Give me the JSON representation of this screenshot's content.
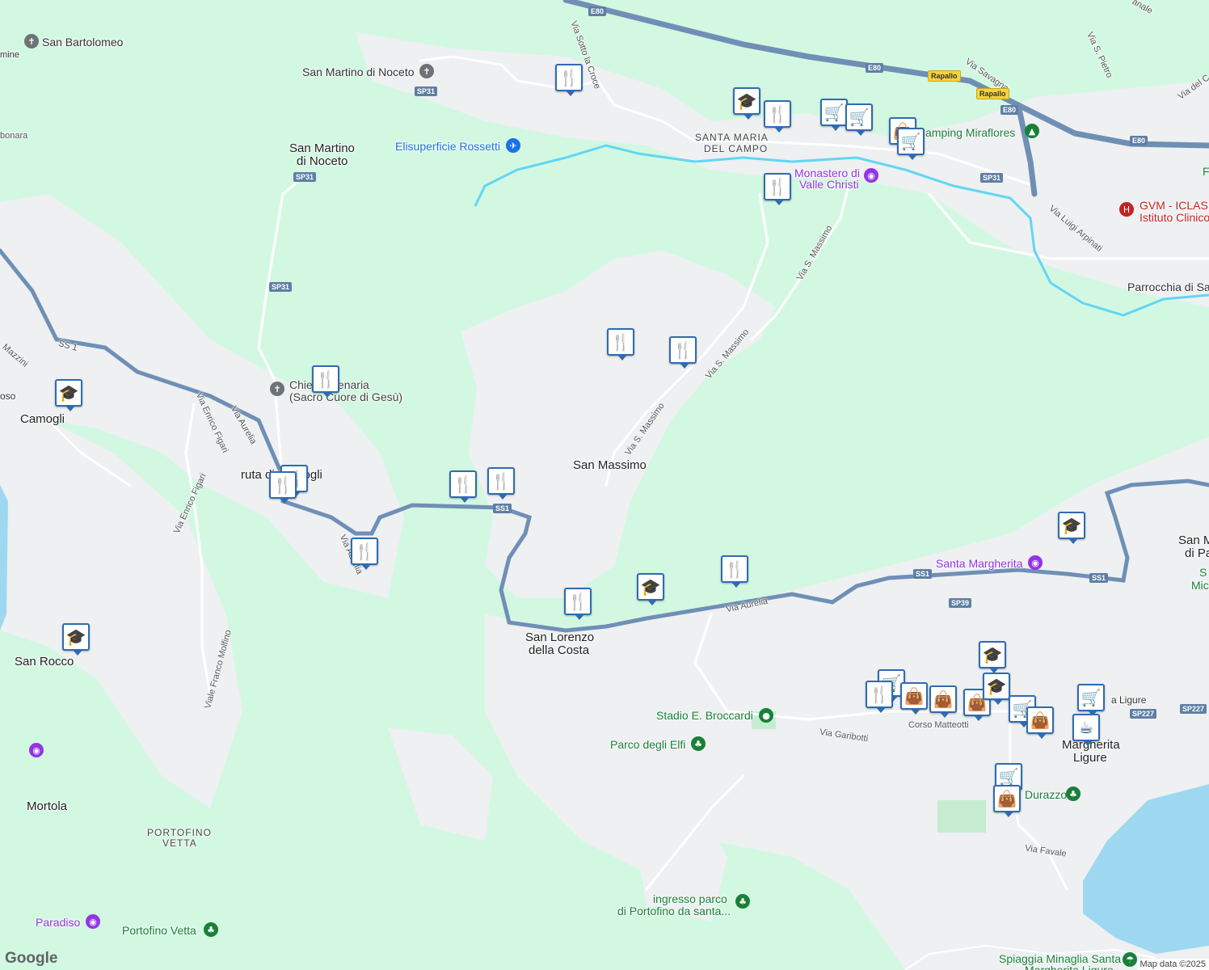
{
  "map": {
    "places": [
      {
        "id": "san-bartolomeo",
        "text": "San Bartolomeo"
      },
      {
        "id": "san-martino-noceto-a",
        "text": "San Martino di Noceto"
      },
      {
        "id": "san-martino-noceto-b1",
        "text": "San Martino"
      },
      {
        "id": "san-martino-noceto-b2",
        "text": "di Noceto"
      },
      {
        "id": "santa-maria-1",
        "text": "SANTA MARIA"
      },
      {
        "id": "santa-maria-2",
        "text": "DEL CAMPO"
      },
      {
        "id": "camogli",
        "text": "Camogli"
      },
      {
        "id": "ruta",
        "text": "ruta di Camogli"
      },
      {
        "id": "san-massimo",
        "text": "San Massimo"
      },
      {
        "id": "san-lorenzo-1",
        "text": "San Lorenzo"
      },
      {
        "id": "san-lorenzo-2",
        "text": "della Costa"
      },
      {
        "id": "san-rocco",
        "text": "San Rocco"
      },
      {
        "id": "mortola",
        "text": "Mortola"
      },
      {
        "id": "portofino-vetta-1",
        "text": "PORTOFINO"
      },
      {
        "id": "portofino-vetta-2",
        "text": "VETTA"
      },
      {
        "id": "san-m-1",
        "text": "San M"
      },
      {
        "id": "san-m-2",
        "text": "di Pa"
      },
      {
        "id": "margherita-1",
        "text": "Margherita"
      },
      {
        "id": "margherita-2",
        "text": "Ligure"
      },
      {
        "id": "parrocchia",
        "text": "Parrocchia di Sa"
      },
      {
        "id": "edge-mine",
        "text": "mine"
      },
      {
        "id": "edge-bonara",
        "text": "bonara"
      },
      {
        "id": "edge-rosso",
        "text": "oso"
      },
      {
        "id": "edge-ligure",
        "text": "a Ligure"
      },
      {
        "id": "edge-sm",
        "text": "S"
      },
      {
        "id": "edge-mic",
        "text": "Mic"
      },
      {
        "id": "edge-f",
        "text": "F"
      }
    ],
    "pois": [
      {
        "id": "elisuperficie",
        "text": "Elisuperficie Rossetti",
        "color": "#1a73e8"
      },
      {
        "id": "monastero-1",
        "text": "Monastero di",
        "color": "#9334e6"
      },
      {
        "id": "monastero-2",
        "text": "Valle Christi",
        "color": "#9334e6"
      },
      {
        "id": "camping",
        "text": "amping Miraflores",
        "color": "#188038"
      },
      {
        "id": "gvm-1",
        "text": "GVM - ICLAS",
        "color": "#c5221f"
      },
      {
        "id": "gvm-2",
        "text": "Istituto Clinico",
        "color": "#c5221f"
      },
      {
        "id": "chiesa-1",
        "text": "Chiesa Plenaria",
        "color": "#444444"
      },
      {
        "id": "chiesa-2",
        "text": "(Sacro Cuore di Gesù)",
        "color": "#444444"
      },
      {
        "id": "santa-margherita",
        "text": "Santa Margherita",
        "color": "#9334e6"
      },
      {
        "id": "stadio",
        "text": "Stadio E. Broccardi",
        "color": "#188038"
      },
      {
        "id": "parco-elfi",
        "text": "Parco degli Elfi",
        "color": "#188038"
      },
      {
        "id": "ingresso-1",
        "text": "ingresso parco",
        "color": "#188038"
      },
      {
        "id": "ingresso-2",
        "text": "di Portofino da santa...",
        "color": "#188038"
      },
      {
        "id": "paradiso",
        "text": "Paradiso",
        "color": "#9334e6"
      },
      {
        "id": "portofino-vetta-poi",
        "text": "Portofino Vetta",
        "color": "#188038"
      },
      {
        "id": "durazzo",
        "text": "Durazzo",
        "color": "#188038"
      },
      {
        "id": "spiaggia-1",
        "text": "Spiaggia Minaglia Santa",
        "color": "#188038"
      },
      {
        "id": "spiaggia-2",
        "text": "Margherita Ligure",
        "color": "#188038"
      }
    ],
    "streets": [
      {
        "id": "via-sotto-la-croce",
        "text": "Via Sotto la Croce"
      },
      {
        "id": "via-savagna",
        "text": "Via Savagna"
      },
      {
        "id": "via-s-pietro",
        "text": "Via S. Pietro"
      },
      {
        "id": "via-del-c",
        "text": "Via del C"
      },
      {
        "id": "via-luigi-arpinati",
        "text": "Via Luigi Arpinati"
      },
      {
        "id": "via-s-massimo-a",
        "text": "Via S. Massimo"
      },
      {
        "id": "via-s-massimo-b",
        "text": "Via S. Massimo"
      },
      {
        "id": "via-s-massimo-c",
        "text": "Via S. Massimo"
      },
      {
        "id": "ss1-label",
        "text": "SS 1"
      },
      {
        "id": "via-mazzini",
        "text": "Mazzini"
      },
      {
        "id": "via-enrico-figari-a",
        "text": "Via Enrico Figari"
      },
      {
        "id": "via-enrico-figari-b",
        "text": "Via Enrico Figari"
      },
      {
        "id": "via-aurelia-a",
        "text": "Via Aurelia"
      },
      {
        "id": "via-aurelia-b",
        "text": "Via Aurelia"
      },
      {
        "id": "via-aurelia-c",
        "text": "Via Aurelia"
      },
      {
        "id": "viale-franco-molfino",
        "text": "Viale Franco Molfino"
      },
      {
        "id": "via-garibotti",
        "text": "Via Garibotti"
      },
      {
        "id": "corso-matteotti",
        "text": "Corso Matteotti"
      },
      {
        "id": "via-favale",
        "text": "Via Favale"
      },
      {
        "id": "anale",
        "text": "anale"
      }
    ],
    "shields": [
      {
        "id": "e80-a",
        "text": "E80",
        "style": "blue"
      },
      {
        "id": "e80-b",
        "text": "E80",
        "style": "blue"
      },
      {
        "id": "e80-c",
        "text": "E80",
        "style": "blue"
      },
      {
        "id": "e80-d",
        "text": "E80",
        "style": "blue"
      },
      {
        "id": "rapallo-a",
        "text": "Rapallo",
        "style": "yellow"
      },
      {
        "id": "rapallo-b",
        "text": "Rapallo",
        "style": "yellow"
      },
      {
        "id": "sp31-a",
        "text": "SP31",
        "style": "blue"
      },
      {
        "id": "sp31-b",
        "text": "SP31",
        "style": "blue"
      },
      {
        "id": "sp31-c",
        "text": "SP31",
        "style": "blue"
      },
      {
        "id": "sp31-d",
        "text": "SP31",
        "style": "blue"
      },
      {
        "id": "ss1-a",
        "text": "SS1",
        "style": "blue"
      },
      {
        "id": "ss1-b",
        "text": "SS1",
        "style": "blue"
      },
      {
        "id": "ss1-c",
        "text": "SS1",
        "style": "blue"
      },
      {
        "id": "sp39",
        "text": "SP39",
        "style": "blue"
      },
      {
        "id": "sp227-a",
        "text": "SP227",
        "style": "blue"
      },
      {
        "id": "sp227-b",
        "text": "SP227",
        "style": "blue"
      }
    ],
    "markers": [
      {
        "id": "m1",
        "type": "restaurant-icon"
      },
      {
        "id": "m2",
        "type": "school-icon"
      },
      {
        "id": "m3",
        "type": "restaurant-icon"
      },
      {
        "id": "m4",
        "type": "shopping-cart-icon"
      },
      {
        "id": "m5",
        "type": "shopping-cart-icon"
      },
      {
        "id": "m6",
        "type": "shopping-bag-icon"
      },
      {
        "id": "m7",
        "type": "shopping-cart-icon"
      },
      {
        "id": "m8",
        "type": "restaurant-icon"
      },
      {
        "id": "m9",
        "type": "restaurant-icon"
      },
      {
        "id": "m10",
        "type": "restaurant-icon"
      },
      {
        "id": "m11",
        "type": "restaurant-icon"
      },
      {
        "id": "m12",
        "type": "school-icon"
      },
      {
        "id": "m13",
        "type": "restaurant-icon"
      },
      {
        "id": "m14",
        "type": "restaurant-icon"
      },
      {
        "id": "m15",
        "type": "restaurant-icon"
      },
      {
        "id": "m16",
        "type": "restaurant-icon"
      },
      {
        "id": "m17",
        "type": "restaurant-icon"
      },
      {
        "id": "m18",
        "type": "school-icon"
      },
      {
        "id": "m19",
        "type": "restaurant-icon"
      },
      {
        "id": "m20",
        "type": "school-icon"
      },
      {
        "id": "m21",
        "type": "school-icon"
      },
      {
        "id": "m22",
        "type": "school-icon"
      },
      {
        "id": "m23",
        "type": "shopping-cart-icon"
      },
      {
        "id": "m24",
        "type": "restaurant-icon"
      },
      {
        "id": "m25",
        "type": "shopping-bag-icon"
      },
      {
        "id": "m26",
        "type": "shopping-bag-icon"
      },
      {
        "id": "m27",
        "type": "shopping-bag-icon"
      },
      {
        "id": "m28",
        "type": "school-icon"
      },
      {
        "id": "m29",
        "type": "shopping-cart-icon"
      },
      {
        "id": "m30",
        "type": "shopping-bag-icon"
      },
      {
        "id": "m31",
        "type": "shopping-cart-icon"
      },
      {
        "id": "m32",
        "type": "cafe-icon"
      },
      {
        "id": "m33",
        "type": "shopping-cart-icon"
      },
      {
        "id": "m34",
        "type": "shopping-bag-icon"
      }
    ],
    "colors": {
      "park": "#d3f8e2",
      "land": "#f1f3f4",
      "water": "#9ed8f0",
      "highway": "#6f8fb5",
      "river": "#62d6f3",
      "marker_border": "#2f6bb2",
      "marker_glyph": "#103b66"
    }
  },
  "branding": {
    "logo": "Google",
    "attribution": "Map data ©2025"
  }
}
